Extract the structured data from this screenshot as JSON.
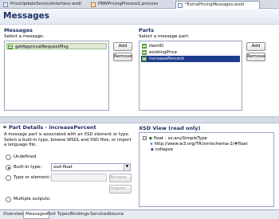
{
  "tabs": [
    {
      "label": "PriceUpdateServiceInterface.wsdl"
    },
    {
      "label": "PBWPricingProcess1.process"
    },
    {
      "label": "*ExtraPricingMessages.wsdl"
    }
  ],
  "header": {
    "title": "Messages"
  },
  "messages": {
    "section_title": "Messages",
    "select_label": "Select a message:",
    "items": [
      {
        "label": "getApprovalRequestMsg"
      }
    ],
    "add_label": "Add",
    "remove_label": "Remove"
  },
  "parts": {
    "section_title": "Parts",
    "select_label": "Select a message part:",
    "items": [
      {
        "label": "itemID"
      },
      {
        "label": "existingPrice"
      },
      {
        "label": "increasePercent"
      }
    ],
    "add_label": "Add",
    "remove_label": "Remove"
  },
  "part_details": {
    "title": "Part Details - increasePercent",
    "description": "A message part is associated with an XSD element or type. Select a built-in type, browse WSDL and XSD files, or import a language file.",
    "options": [
      {
        "label": "Undefined",
        "selected": false
      },
      {
        "label": "Built-in type:",
        "selected": true
      },
      {
        "label": "Type or element:",
        "selected": false
      },
      {
        "label": "Multiple outputs:",
        "selected": false
      }
    ],
    "builtin_value": "xsd:float",
    "browse_label": "Browse...",
    "import_label": "Import..."
  },
  "xsd_view": {
    "title": "XSD View (read only)",
    "lines": [
      {
        "text": "float : xs:anySimpleType"
      },
      {
        "text": "http://www.w3.org/TR/xmlschema-2/#float"
      },
      {
        "text": "collapse"
      }
    ]
  },
  "bottom_tabs": [
    {
      "label": "Overview"
    },
    {
      "label": "Messages"
    },
    {
      "label": "Port Types"
    },
    {
      "label": "Bindings"
    },
    {
      "label": "Services"
    },
    {
      "label": "Source"
    }
  ]
}
